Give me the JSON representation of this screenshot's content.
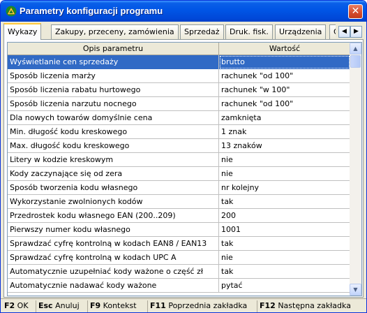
{
  "window": {
    "title": "Parametry konfiguracji programu",
    "icon": "app-triangle-icon",
    "close_glyph": "✕"
  },
  "tabs": [
    {
      "label": "Wykazy",
      "active": true
    },
    {
      "label": "Zakupy, przeceny, zamówienia",
      "active": false
    },
    {
      "label": "Sprzedaż",
      "active": false
    },
    {
      "label": "Druk. fisk.",
      "active": false
    },
    {
      "label": "Urządzenia",
      "active": false
    },
    {
      "label": "O",
      "active": false
    }
  ],
  "tab_scroll": {
    "left": "◀",
    "right": "▶"
  },
  "grid": {
    "columns": [
      "Opis parametru",
      "Wartość"
    ],
    "selected_row": 0,
    "rows": [
      [
        "Wyświetlanie cen sprzedaży",
        "brutto"
      ],
      [
        "Sposób liczenia marży",
        "rachunek \"od 100\""
      ],
      [
        "Sposób liczenia rabatu hurtowego",
        "rachunek \"w 100\""
      ],
      [
        "Sposób liczenia narzutu nocnego",
        "rachunek \"od 100\""
      ],
      [
        "Dla nowych towarów domyślnie cena",
        "zamknięta"
      ],
      [
        "Min. długość kodu kreskowego",
        "1 znak"
      ],
      [
        "Max. długość kodu kreskowego",
        "13 znaków"
      ],
      [
        "Litery w kodzie kreskowym",
        "nie"
      ],
      [
        "Kody zaczynające się od zera",
        "nie"
      ],
      [
        "Sposób tworzenia kodu własnego",
        "nr kolejny"
      ],
      [
        "Wykorzystanie zwolnionych kodów",
        "tak"
      ],
      [
        "Przedrostek kodu własnego EAN (200..209)",
        "200"
      ],
      [
        "Pierwszy numer kodu własnego",
        "1001"
      ],
      [
        "Sprawdzać cyfrę kontrolną w kodach EAN8 / EAN13",
        "tak"
      ],
      [
        "Sprawdzać cyfrę kontrolną w kodach UPC A",
        "nie"
      ],
      [
        "Automatycznie uzupełniać kody ważone o część zł",
        "tak"
      ],
      [
        "Automatycznie nadawać kody ważone",
        "pytać"
      ]
    ]
  },
  "scrollbar": {
    "up": "▲",
    "down": "▼"
  },
  "statusbar": [
    {
      "key": "F2",
      "label": "OK"
    },
    {
      "key": "Esc",
      "label": "Anuluj"
    },
    {
      "key": "F9",
      "label": "Kontekst"
    },
    {
      "key": "F11",
      "label": "Poprzednia zakładka"
    },
    {
      "key": "F12",
      "label": "Następna zakładka"
    }
  ],
  "colors": {
    "titlebar": "#0055e5",
    "selection": "#316ac5",
    "active_tab_accent": "#ffc83c",
    "close_button": "#d44a2c"
  }
}
